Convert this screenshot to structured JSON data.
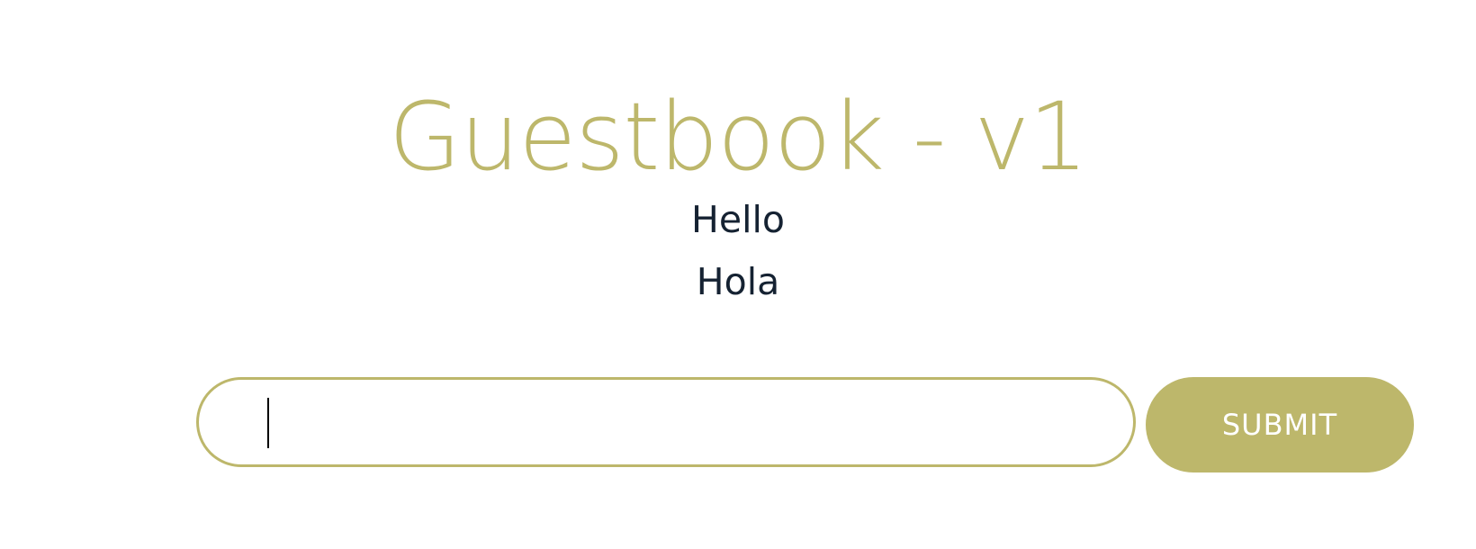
{
  "page": {
    "title": "Guestbook - v1"
  },
  "messages": [
    "Hello",
    "Hola"
  ],
  "form": {
    "input_value": "",
    "input_placeholder": "",
    "submit_label": "SUBMIT"
  },
  "colors": {
    "accent": "#bdb76b",
    "text": "#152232",
    "background": "#ffffff"
  }
}
